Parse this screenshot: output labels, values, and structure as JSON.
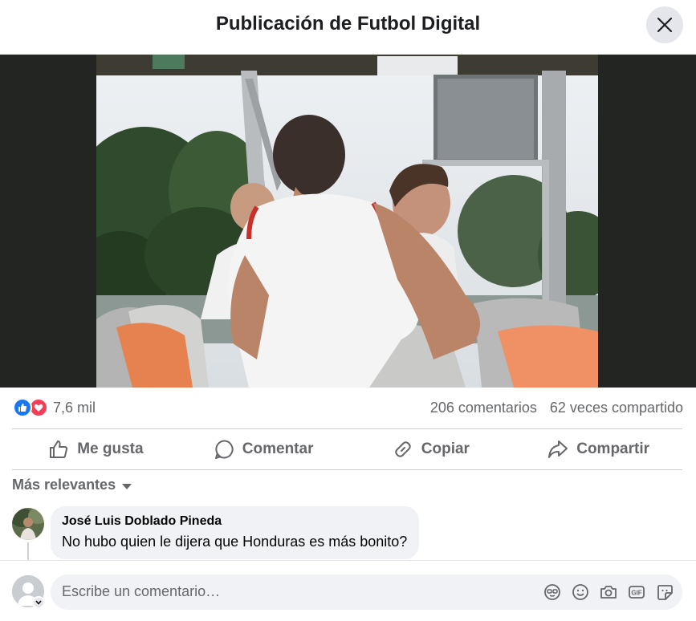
{
  "header": {
    "title": "Publicación de Futbol Digital"
  },
  "icons": {
    "close": "close-icon",
    "like_reaction": "thumbs-up-icon",
    "love_reaction": "heart-icon",
    "like_action": "thumbs-up-outline-icon",
    "comment_action": "speech-bubble-icon",
    "copy_action": "link-icon",
    "share_action": "share-arrow-icon",
    "avatar_sticker": "avatar-sticker-icon",
    "emoji": "smiley-icon",
    "camera": "camera-icon",
    "gif": "gif-icon",
    "sticker": "sticker-icon"
  },
  "post": {
    "reaction_count": "7,6 mil",
    "comments_count": "206 comentarios",
    "shares_count": "62 veces compartido"
  },
  "actions": {
    "like": "Me gusta",
    "comment": "Comentar",
    "copy": "Copiar",
    "share": "Compartir"
  },
  "comments_sort": {
    "label": "Más relevantes"
  },
  "comments": [
    {
      "author": "José Luis Doblado Pineda",
      "text": "No hubo quien le dijera que Honduras es más bonito?"
    }
  ],
  "composer": {
    "placeholder": "Escribe un comentario…",
    "gif_label": "GIF"
  },
  "colors": {
    "brand_blue": "#1877f2",
    "love_red": "#f33e58",
    "secondary_text": "#65676b",
    "surface_gray": "#f0f2f5"
  }
}
